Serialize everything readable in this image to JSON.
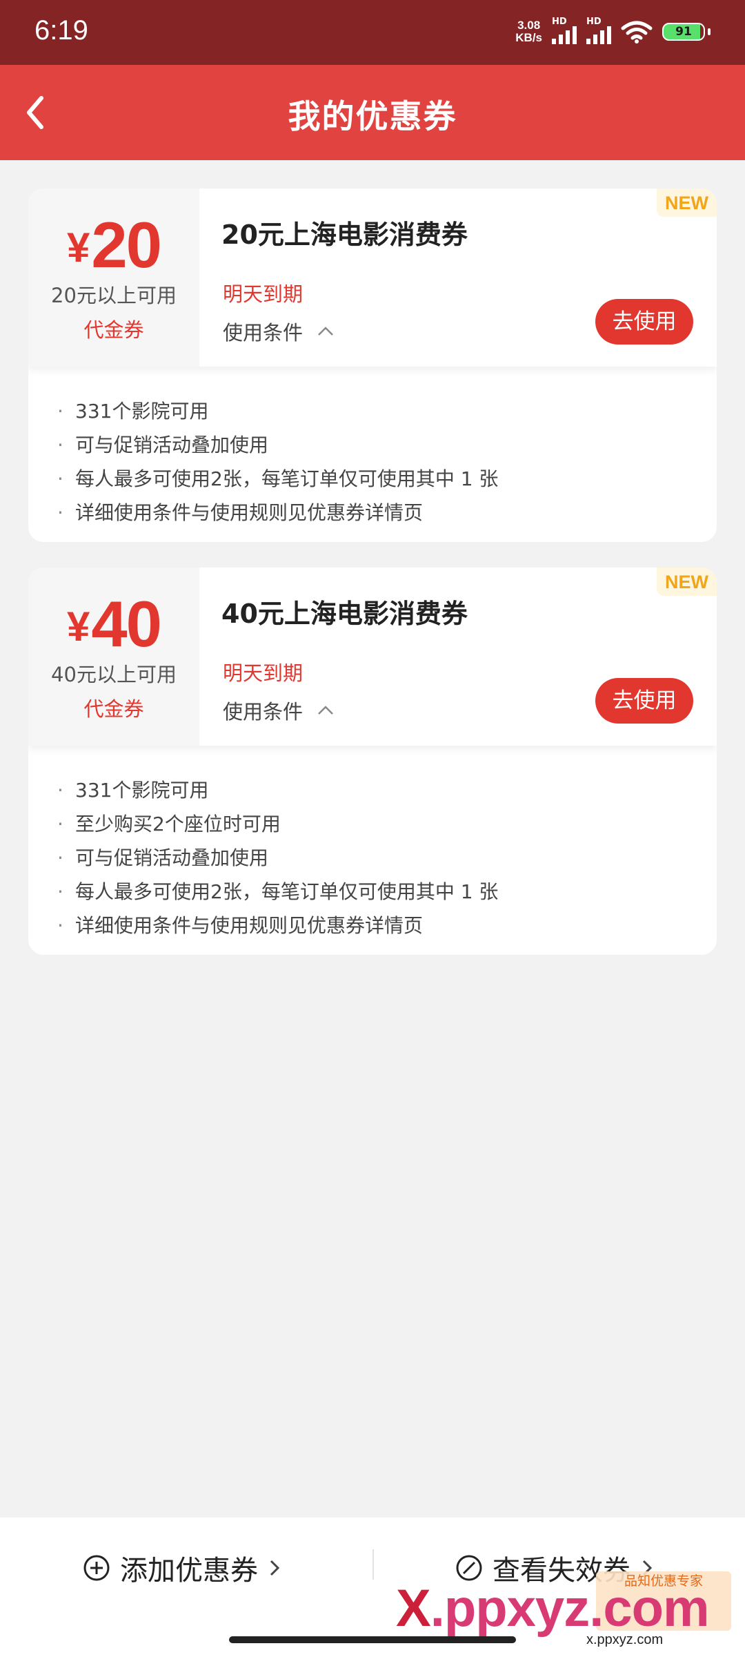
{
  "status_bar": {
    "time": "6:19",
    "net_speed_value": "3.08",
    "net_speed_unit": "KB/s",
    "signal_label": "HD",
    "battery": "91"
  },
  "header": {
    "title": "我的优惠券"
  },
  "coupons": [
    {
      "currency": "¥",
      "amount": "20",
      "min_req": "20元以上可用",
      "type": "代金券",
      "name": "20元上海电影消费券",
      "expiry": "明天到期",
      "conditions_label": "使用条件",
      "badge": "NEW",
      "button": "去使用",
      "rules": [
        "331个影院可用",
        "可与促销活动叠加使用",
        "每人最多可使用2张，每笔订单仅可使用其中 1 张",
        "详细使用条件与使用规则见优惠券详情页"
      ]
    },
    {
      "currency": "¥",
      "amount": "40",
      "min_req": "40元以上可用",
      "type": "代金券",
      "name": "40元上海电影消费券",
      "expiry": "明天到期",
      "conditions_label": "使用条件",
      "badge": "NEW",
      "button": "去使用",
      "rules": [
        "331个影院可用",
        "至少购买2个座位时可用",
        "可与促销活动叠加使用",
        "每人最多可使用2张，每笔订单仅可使用其中 1 张",
        "详细使用条件与使用规则见优惠券详情页"
      ]
    }
  ],
  "bottom_bar": {
    "add_label": "添加优惠券",
    "expired_label": "查看失效券"
  },
  "watermark": {
    "x": "X",
    "rest": ".ppxyz.com",
    "logo_text": "品知优惠专家",
    "url": "x.ppxyz.com"
  },
  "colors": {
    "status_bar": "#852424",
    "header": "#e04340",
    "accent_red": "#e2372f",
    "new_badge": "#f1a51a",
    "background": "#f2f2f2"
  }
}
